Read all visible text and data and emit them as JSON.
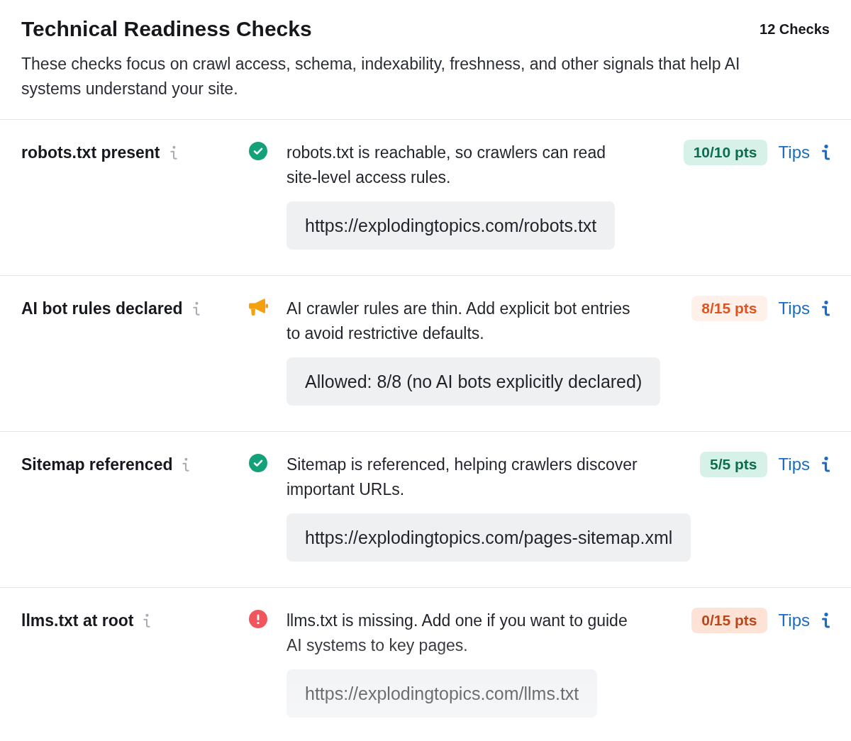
{
  "header": {
    "title": "Technical Readiness Checks",
    "count": "12 Checks",
    "description": "These checks focus on crawl access, schema, indexability, freshness, and other signals that help AI systems understand your site."
  },
  "checks": [
    {
      "name": "robots.txt present",
      "kind": "pass",
      "message": "robots.txt is reachable, so crawlers can read site-level access rules.",
      "points": "10/10 pts",
      "tips": "Tips",
      "evidence": "https://explodingtopics.com/robots.txt"
    },
    {
      "name": "AI bot rules declared",
      "kind": "warn",
      "message": "AI crawler rules are thin. Add explicit bot entries to avoid restrictive defaults.",
      "points": "8/15 pts",
      "tips": "Tips",
      "evidence": "Allowed: 8/8 (no AI bots explicitly declared)"
    },
    {
      "name": "Sitemap referenced",
      "kind": "pass",
      "message": "Sitemap is referenced, helping crawlers discover important URLs.",
      "points": "5/5 pts",
      "tips": "Tips",
      "evidence": "https://explodingtopics.com/pages-sitemap.xml"
    },
    {
      "name": "llms.txt at root",
      "kind": "fail",
      "message": "llms.txt is missing. Add one if you want to guide AI systems to key pages.",
      "points": "0/15 pts",
      "tips": "Tips",
      "evidence": "https://explodingtopics.com/llms.txt"
    }
  ]
}
